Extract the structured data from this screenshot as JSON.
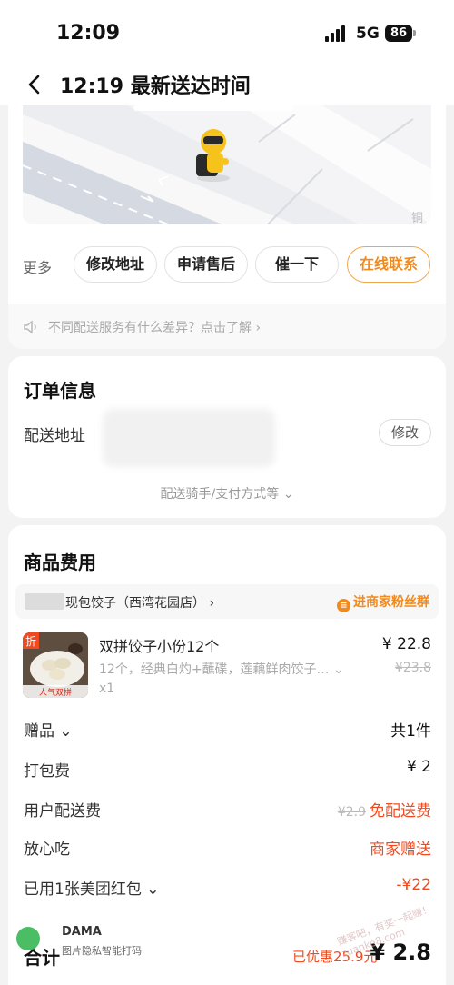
{
  "status_bar": {
    "time": "12:09",
    "network": "5G",
    "battery": "86"
  },
  "header": {
    "title": "12:19 最新送达时间"
  },
  "map": {
    "label": "铜"
  },
  "actions": {
    "more_label": "更多",
    "buttons": [
      "修改地址",
      "申请售后",
      "催一下",
      "在线联系"
    ]
  },
  "notice": {
    "text": "不同配送服务有什么差异？点击了解 ›"
  },
  "order_info": {
    "title": "订单信息",
    "address_label": "配送地址",
    "edit_label": "修改",
    "more": "配送骑手/支付方式等 ⌄"
  },
  "goods": {
    "title": "商品费用",
    "shop_name": "现包饺子（西湾花园店） ›",
    "fans_group": "进商家粉丝群",
    "item": {
      "badge": "折",
      "name": "双拼饺子小份12个",
      "price": "¥ 22.8",
      "desc": "12个，经典白灼+蘸碟，莲藕鲜肉饺子…  ⌄",
      "original_price": "¥23.8",
      "qty": "x1",
      "thumb_text": "人气双拼"
    },
    "fees": [
      {
        "label": "赠品 ⌄",
        "value": "共1件"
      },
      {
        "label": "打包费",
        "value": "¥ 2"
      },
      {
        "label": "用户配送费",
        "strike": "¥2.9",
        "value": "免配送费"
      },
      {
        "label": "放心吃",
        "value": "商家赠送"
      },
      {
        "label": "已用1张美团红包 ⌄",
        "value": "-¥22"
      }
    ],
    "total_label": "合计",
    "saved": "已优惠25.9元",
    "total": "¥ 2.8"
  },
  "watermark": {
    "line1": "DAMA",
    "line2": "图片隐私智能打码",
    "site": "赚客吧，有奖一起赚！ zuanke8.com"
  },
  "colors": {
    "accent": "#f08a1e",
    "red": "#f04a1e",
    "background": "#f3f3f3"
  }
}
